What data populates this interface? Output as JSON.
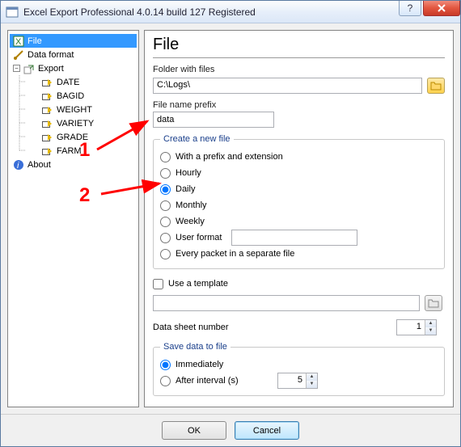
{
  "window": {
    "title": "Excel Export Professional 4.0.14 build 127 Registered"
  },
  "tree": {
    "file": "File",
    "dataformat": "Data format",
    "export": "Export",
    "fields": [
      "DATE",
      "BAGID",
      "WEIGHT",
      "VARIETY",
      "GRADE",
      "FARM"
    ],
    "about": "About"
  },
  "page": {
    "heading": "File",
    "folder_label": "Folder with files",
    "folder_value": "C:\\Logs\\",
    "prefix_label": "File name prefix",
    "prefix_value": "data",
    "create_legend": "Create a new file",
    "opts": {
      "prefix_ext": "With a prefix and extension",
      "hourly": "Hourly",
      "daily": "Daily",
      "monthly": "Monthly",
      "weekly": "Weekly",
      "user_format": "User format",
      "every_packet": "Every packet in a separate file"
    },
    "use_template": "Use a template",
    "datasheet_label": "Data sheet number",
    "datasheet_value": "1",
    "save_legend": "Save data to file",
    "save_immediately": "Immediately",
    "save_after_interval": "After interval (s)",
    "interval_value": "5"
  },
  "buttons": {
    "ok": "OK",
    "cancel": "Cancel"
  },
  "annotations": {
    "one": "1",
    "two": "2"
  }
}
